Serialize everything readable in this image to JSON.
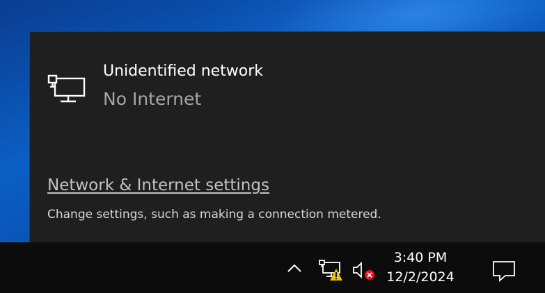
{
  "flyout": {
    "network": {
      "name": "Unidentified network",
      "status": "No Internet",
      "icon": "wired-network-icon"
    },
    "settings_link": "Network & Internet settings",
    "settings_desc": "Change settings, such as making a connection metered."
  },
  "taskbar": {
    "tray_icons": [
      "chevron-up-icon",
      "network-warning-icon",
      "speaker-muted-icon"
    ],
    "clock": {
      "time": "3:40 PM",
      "date": "12/2/2024"
    },
    "action_center_icon": "notification-icon"
  },
  "colors": {
    "flyout_bg": "#1f1f1f",
    "taskbar_bg": "#0c0c0c",
    "warning": "#f2c200",
    "error": "#e81123"
  }
}
